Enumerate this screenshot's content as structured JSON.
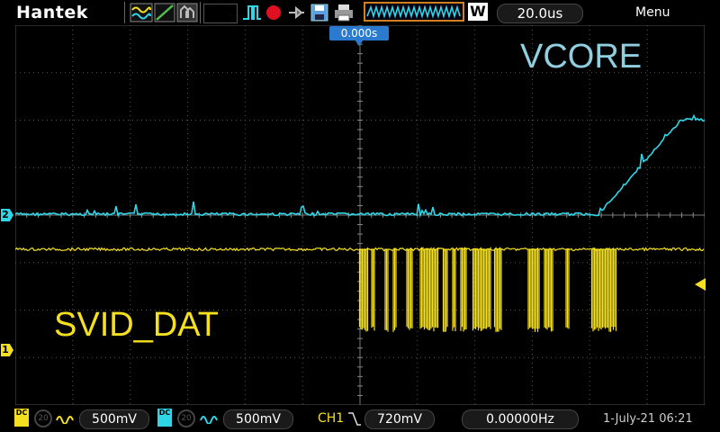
{
  "header": {
    "brand": "Hantek",
    "timebase": "20.0us",
    "wave_badge": "W",
    "menu_label": "Menu",
    "trigger_position": "0.000s"
  },
  "labels": {
    "vcore": "VCORE",
    "svid_dat": "SVID_DAT"
  },
  "markers": {
    "ch2": "2",
    "ch1": "1"
  },
  "footer": {
    "ch1_coupling": "DC",
    "ch1_bw": "20",
    "ch1_scale": "500mV",
    "ch2_coupling": "DC",
    "ch2_bw": "20",
    "ch2_scale": "500mV",
    "trigger_source": "CH1",
    "trigger_level": "720mV",
    "frequency": "0.00000Hz",
    "datetime": "1-July-21 06:21"
  },
  "colors": {
    "ch1": "#f5e020",
    "ch2": "#2fd6e6",
    "grid": "#555555",
    "accent": "#2a7ad0"
  },
  "icons": [
    "wave-mode-icon",
    "line-mode-icon",
    "persist-icon",
    "single-pulse-icon",
    "record-icon",
    "probe-icon",
    "save-icon",
    "print-icon"
  ]
}
